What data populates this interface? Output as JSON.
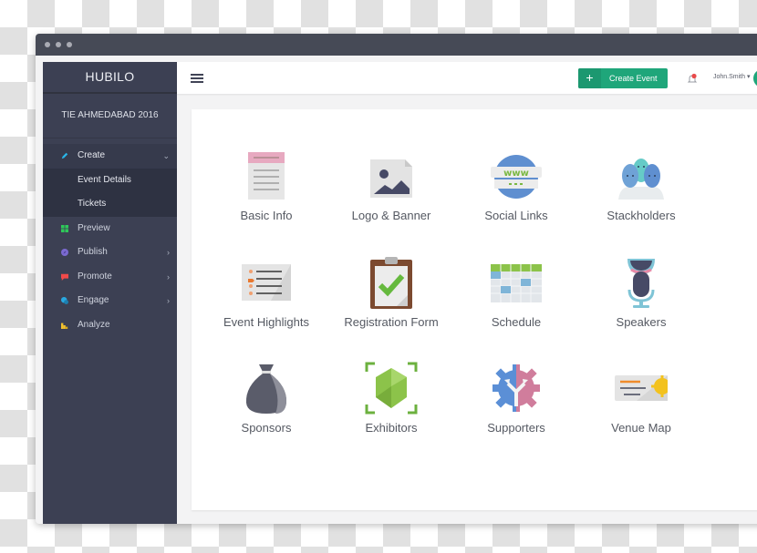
{
  "window": {
    "controls": [
      "dot",
      "dot",
      "dot"
    ]
  },
  "sidebar": {
    "brand": "HUBILO",
    "event_name": "TIE AHMEDABAD 2016",
    "items": [
      {
        "label": "Create",
        "icon": "pencil-icon",
        "color": "#29b6e8",
        "expanded": true,
        "children": [
          {
            "label": "Event Details"
          },
          {
            "label": "Tickets"
          }
        ]
      },
      {
        "label": "Preview",
        "icon": "grid-icon",
        "color": "#2ec85a"
      },
      {
        "label": "Publish",
        "icon": "compass-icon",
        "color": "#7b6ad0",
        "has_submenu": true
      },
      {
        "label": "Promote",
        "icon": "megaphone-icon",
        "color": "#f04a4a",
        "has_submenu": true
      },
      {
        "label": "Engage",
        "icon": "chat-icon",
        "color": "#29a8e0",
        "has_submenu": true
      },
      {
        "label": "Analyze",
        "icon": "bar-chart-icon",
        "color": "#f2c12e"
      }
    ],
    "chevron_down": "⌄",
    "chevron_right": "›"
  },
  "topbar": {
    "create_button": {
      "icon": "+",
      "label": "Create Event",
      "color": "#1fa67a"
    },
    "notification_badge_color": "#e84a4a",
    "user_name": "John.Smith ▾"
  },
  "tiles": [
    {
      "label": "Basic  Info",
      "icon": "document-icon"
    },
    {
      "label": "Logo & Banner",
      "icon": "image-icon"
    },
    {
      "label": "Social Links",
      "icon": "www-globe-icon"
    },
    {
      "label": "Stackholders",
      "icon": "people-icon"
    },
    {
      "label": "Event Highlights",
      "icon": "list-card-icon"
    },
    {
      "label": "Registration Form",
      "icon": "clipboard-check-icon"
    },
    {
      "label": "Schedule",
      "icon": "calendar-icon"
    },
    {
      "label": "Speakers",
      "icon": "microphone-icon"
    },
    {
      "label": "Sponsors",
      "icon": "money-bag-icon"
    },
    {
      "label": "Exhibitors",
      "icon": "gem-icon"
    },
    {
      "label": "Supporters",
      "icon": "gear-icon"
    },
    {
      "label": "Venue Map",
      "icon": "ticket-icon"
    }
  ]
}
